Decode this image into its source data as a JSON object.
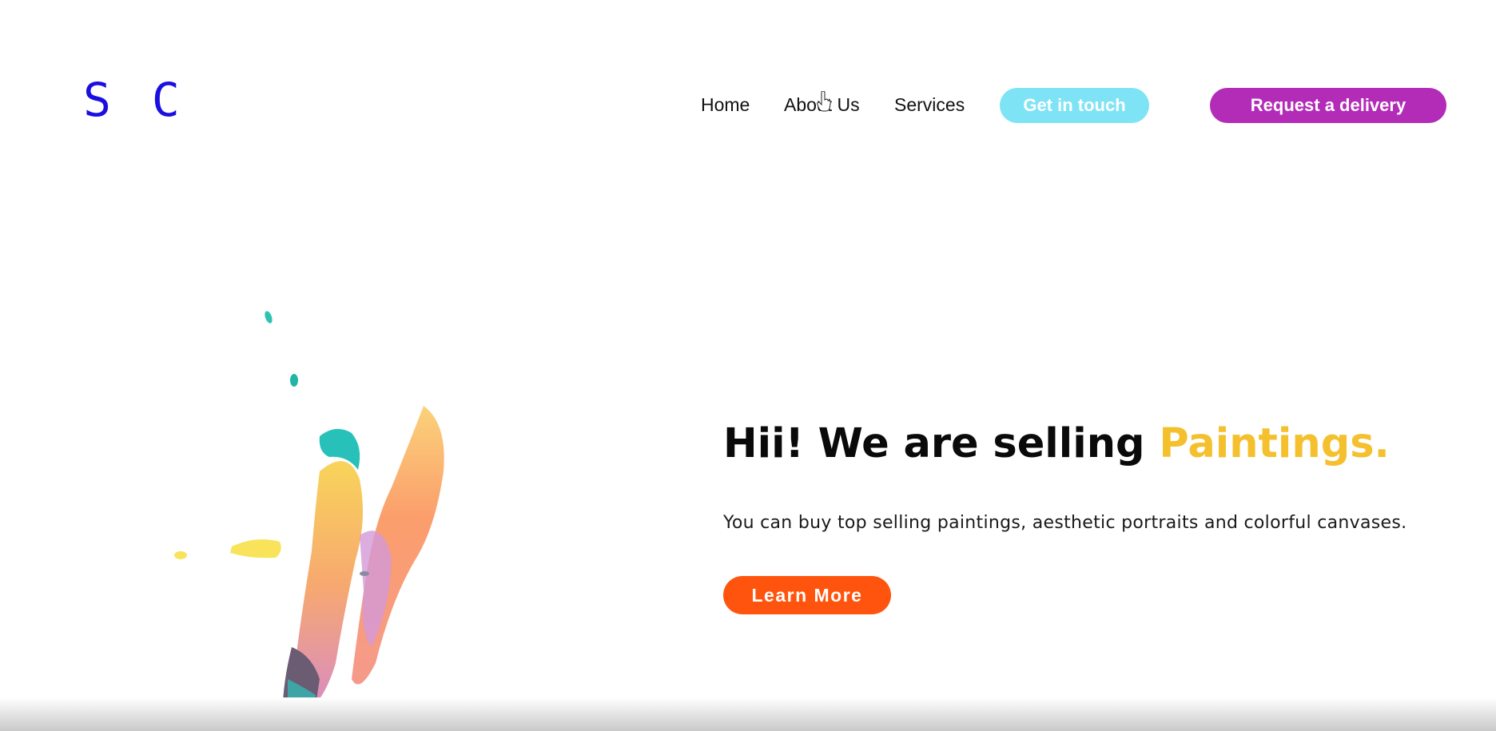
{
  "logo": {
    "text": "S C",
    "color": "#1a0fe0"
  },
  "nav": {
    "links": [
      "Home",
      "About Us",
      "Services"
    ],
    "get_in_touch": "Get in touch",
    "request_delivery": "Request a delivery"
  },
  "hero": {
    "title_main": "Hii! We are selling ",
    "title_accent": "Paintings.",
    "subtitle": "You can buy top selling paintings, aesthetic portraits and colorful canvases.",
    "cta": "Learn More"
  },
  "colors": {
    "get_in_touch_bg": "#7fe3f6",
    "request_delivery_bg": "#b32cb8",
    "cta_bg": "#ff540d",
    "accent": "#f4c02e"
  },
  "icons": {
    "cursor": "hand-pointer-icon",
    "art": "paint-brush-splash"
  }
}
